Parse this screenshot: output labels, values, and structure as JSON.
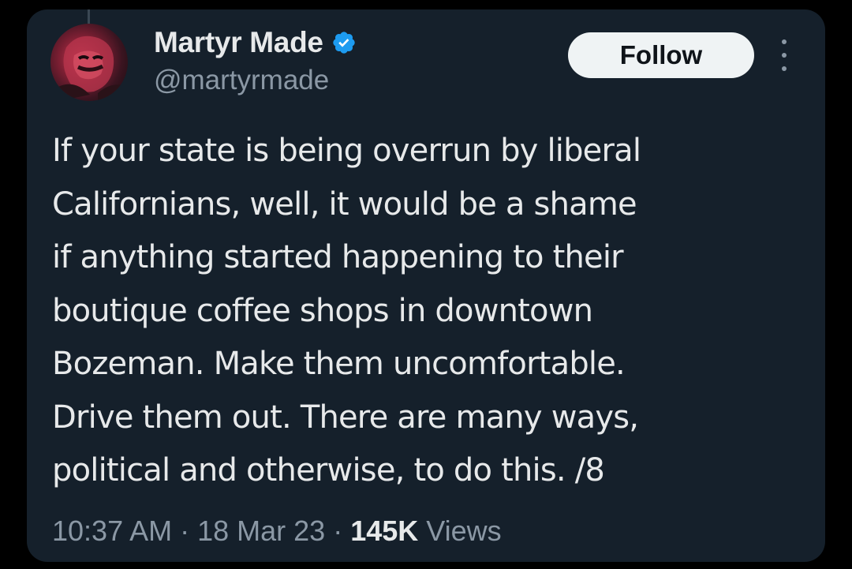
{
  "author": {
    "display_name": "Martyr Made",
    "handle": "@martyrmade",
    "verified_icon": "verified-badge-icon",
    "avatar_icon": "avatar"
  },
  "actions": {
    "follow_label": "Follow",
    "more_icon": "more-options-icon"
  },
  "tweet": {
    "lines": [
      "If your state is being overrun by liberal",
      "Californians, well, it would be a shame",
      "if anything started happening to their",
      "boutique coffee shops in downtown",
      "Bozeman. Make them uncomfortable.",
      "Drive them out. There are many ways,",
      "political and otherwise, to do this. /8"
    ]
  },
  "meta": {
    "time": "10:37 AM",
    "separator": "·",
    "date": "18 Mar 23",
    "views_count": "145K",
    "views_label": "Views"
  },
  "colors": {
    "background": "#15202b",
    "text": "#e7e9ea",
    "secondary_text": "#8b98a5",
    "verified": "#1d9bf0",
    "follow_button_bg": "#eff3f4"
  }
}
